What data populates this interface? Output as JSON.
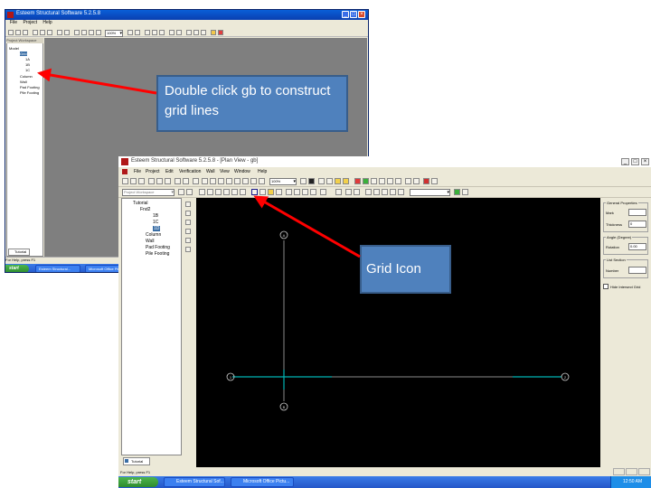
{
  "back_window": {
    "title": "Esteem Structural Software 5.2.5.8",
    "menu": [
      "File",
      "Project",
      "Help"
    ],
    "zoom": "100%",
    "panel_header": "Project Workspace",
    "tree": [
      "Model",
      "Grid",
      "1A",
      "1B",
      "1C",
      "Column",
      "Wall",
      "Pad Footing",
      "Pile Footing"
    ],
    "tree_tab": "Tutorial",
    "status": "For Help, press F1",
    "taskbar": {
      "start": "start",
      "items": [
        "Esteem Structural...",
        "Microsoft Office Pic..."
      ]
    }
  },
  "main_window": {
    "title": "Esteem Structural Software 5.2.5.8 - [Plan View - gb]",
    "menu": [
      "File",
      "Project",
      "Edit",
      "Verification",
      "Wall",
      "View",
      "Window",
      "Help"
    ],
    "zoom": "100%",
    "panel_header": "Project Workspace",
    "tree": [
      "Tutorial",
      "Fnd2",
      "1B",
      "1C",
      "1D",
      "Column",
      "Wall",
      "Pad Footing",
      "Pile Footing"
    ],
    "tree_tab": "Tutorial",
    "grid_labels": {
      "top": "A",
      "bottom": "B",
      "left": "1",
      "right": "2"
    },
    "properties": {
      "general_title": "General Properties",
      "mark_label": "Mark",
      "mark_value": "",
      "thickness_label": "Thickness",
      "thickness_value": "0",
      "angle_title": "Angle (Degree)",
      "rotation_label": "Rotation",
      "rotation_value": "0.00",
      "section_title": "List Section",
      "number_label": "Number",
      "number_value": "",
      "checkbox_label": "Hide Intersect Grid"
    },
    "status": "For Help, press F1",
    "taskbar": {
      "start": "start",
      "items": [
        "Esteem Structural Sof...",
        "Microsoft Office Pictu..."
      ],
      "clock": "12:50 AM"
    }
  },
  "callouts": {
    "double_click": "Double click gb to construct grid lines",
    "grid_icon": "Grid Icon"
  },
  "colors": {
    "callout_fill": "#4f81bd",
    "arrow": "#ff0000",
    "grid_line": "#00b4b4",
    "canvas": "#000000",
    "back_canvas": "#7f7f7f"
  }
}
